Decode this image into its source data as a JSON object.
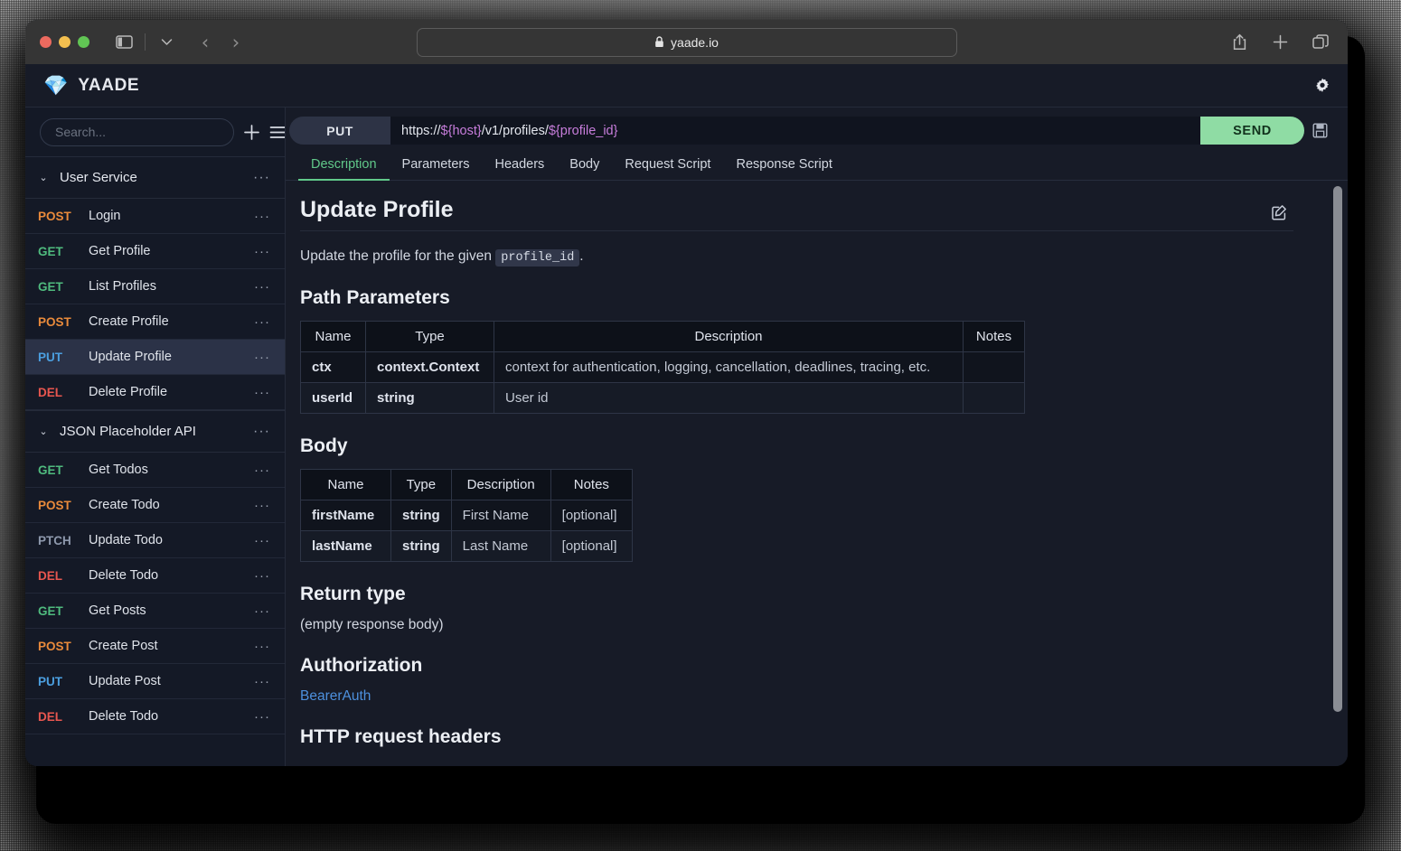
{
  "browser": {
    "url": "yaade.io",
    "lock_icon": "lock-icon",
    "sidebar_toggle_icon": "sidebar-toggle-icon",
    "chevron_down_icon": "chevron-down-icon",
    "back_icon": "‹",
    "forward_icon": "›",
    "share_icon": "share-icon",
    "new_tab_icon": "plus-icon",
    "tabs_overview_icon": "tabs-overview-icon"
  },
  "app": {
    "logo_icon": "gem-icon",
    "logo_glyph": "💎",
    "name": "YAADE",
    "settings_icon": "gear-icon"
  },
  "sidebar": {
    "search_placeholder": "Search...",
    "add_icon": "plus-icon",
    "menu_icon": "hamburger-menu-icon",
    "overflow_glyph": "···",
    "collections": [
      {
        "name": "User Service",
        "expanded": true,
        "requests": [
          {
            "method": "POST",
            "name": "Login",
            "selected": false
          },
          {
            "method": "GET",
            "name": "Get Profile",
            "selected": false
          },
          {
            "method": "GET",
            "name": "List Profiles",
            "selected": false
          },
          {
            "method": "POST",
            "name": "Create Profile",
            "selected": false
          },
          {
            "method": "PUT",
            "name": "Update Profile",
            "selected": true
          },
          {
            "method": "DEL",
            "name": "Delete Profile",
            "selected": false
          }
        ]
      },
      {
        "name": "JSON Placeholder API",
        "expanded": true,
        "requests": [
          {
            "method": "GET",
            "name": "Get Todos",
            "selected": false
          },
          {
            "method": "POST",
            "name": "Create Todo",
            "selected": false
          },
          {
            "method": "PTCH",
            "name": "Update Todo",
            "selected": false
          },
          {
            "method": "DEL",
            "name": "Delete Todo",
            "selected": false
          },
          {
            "method": "GET",
            "name": "Get Posts",
            "selected": false
          },
          {
            "method": "POST",
            "name": "Create Post",
            "selected": false
          },
          {
            "method": "PUT",
            "name": "Update Post",
            "selected": false
          },
          {
            "method": "DEL",
            "name": "Delete Todo",
            "selected": false
          }
        ]
      }
    ]
  },
  "request": {
    "method": "PUT",
    "url_parts": [
      {
        "text": "https://",
        "template": false
      },
      {
        "text": "${host}",
        "template": true
      },
      {
        "text": "/v1/profiles/",
        "template": false
      },
      {
        "text": "${profile_id}",
        "template": true
      }
    ],
    "url_full": "https://${host}/v1/profiles/${profile_id}",
    "send_label": "SEND",
    "save_icon": "save-floppy-icon",
    "tabs": [
      {
        "label": "Description",
        "active": true
      },
      {
        "label": "Parameters",
        "active": false
      },
      {
        "label": "Headers",
        "active": false
      },
      {
        "label": "Body",
        "active": false
      },
      {
        "label": "Request Script",
        "active": false
      },
      {
        "label": "Response Script",
        "active": false
      }
    ]
  },
  "doc": {
    "title": "Update Profile",
    "edit_icon": "edit-pencil-icon",
    "intro_before": "Update the profile for the given ",
    "intro_code": "profile_id",
    "intro_after": ".",
    "path_params": {
      "heading": "Path Parameters",
      "columns": [
        "Name",
        "Type",
        "Description",
        "Notes"
      ],
      "rows": [
        {
          "name": "ctx",
          "type": "context.Context",
          "description": "context for authentication, logging, cancellation, deadlines, tracing, etc.",
          "notes": ""
        },
        {
          "name": "userId",
          "type": "string",
          "description": "User id",
          "notes": ""
        }
      ]
    },
    "body": {
      "heading": "Body",
      "columns": [
        "Name",
        "Type",
        "Description",
        "Notes"
      ],
      "rows": [
        {
          "name": "firstName",
          "type": "string",
          "description": "First Name",
          "notes": "[optional]"
        },
        {
          "name": "lastName",
          "type": "string",
          "description": "Last Name",
          "notes": "[optional]"
        }
      ]
    },
    "return_type": {
      "heading": "Return type",
      "text": "(empty response body)"
    },
    "authorization": {
      "heading": "Authorization",
      "link": "BearerAuth"
    },
    "http_headers": {
      "heading": "HTTP request headers"
    }
  },
  "colors": {
    "accent_green": "#8fdca4",
    "tab_active": "#61c98a",
    "method_post": "#e98a3b",
    "method_get": "#4fbb7e",
    "method_put": "#4b9fe0",
    "method_del": "#e8564f",
    "method_patch": "#8e99ad",
    "link": "#4d90dd",
    "template_var": "#c77ddb",
    "selected_row": "#2b3247"
  }
}
